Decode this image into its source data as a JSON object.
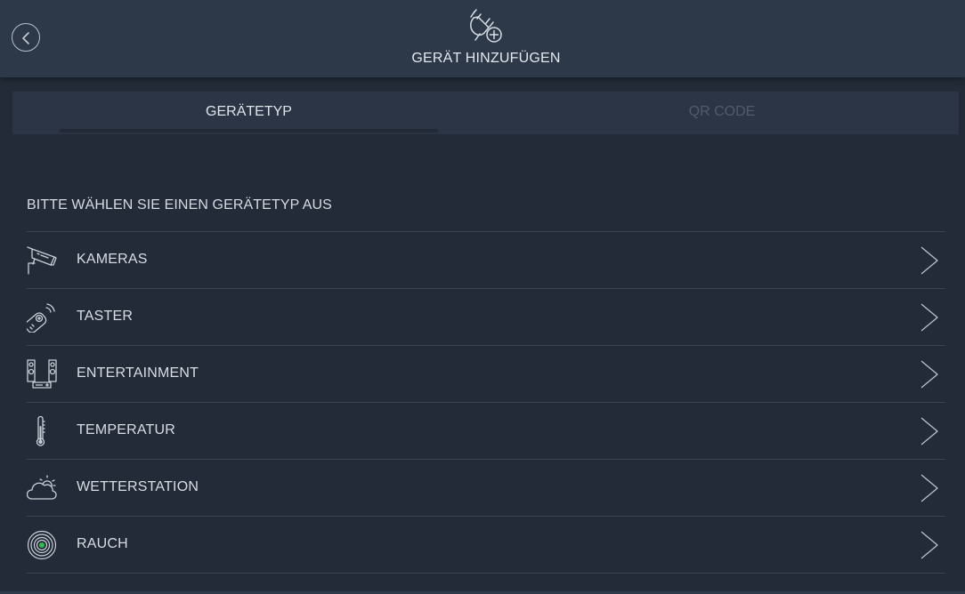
{
  "header": {
    "title": "GERÄT HINZUFÜGEN",
    "icon": "plug-add-icon"
  },
  "tabs": [
    {
      "label": "GERÄTETYP",
      "active": true
    },
    {
      "label": "QR CODE",
      "active": false
    }
  ],
  "section": {
    "label": "BITTE WÄHLEN SIE EINEN GERÄTETYP AUS"
  },
  "devices": [
    {
      "label": "KAMERAS",
      "icon": "camera-icon"
    },
    {
      "label": "TASTER",
      "icon": "remote-control-icon"
    },
    {
      "label": "ENTERTAINMENT",
      "icon": "speakers-icon"
    },
    {
      "label": "TEMPERATUR",
      "icon": "thermometer-icon"
    },
    {
      "label": "WETTERSTATION",
      "icon": "weather-icon"
    },
    {
      "label": "RAUCH",
      "icon": "smoke-detector-icon"
    }
  ],
  "colors": {
    "background": "#232b38",
    "header": "#2d3848",
    "tabs": "#2b3545",
    "text": "#d9dee5",
    "inactive_tab": "#4f5b6b",
    "divider": "#3a4454",
    "smoke_led": "#2fbf4a"
  }
}
